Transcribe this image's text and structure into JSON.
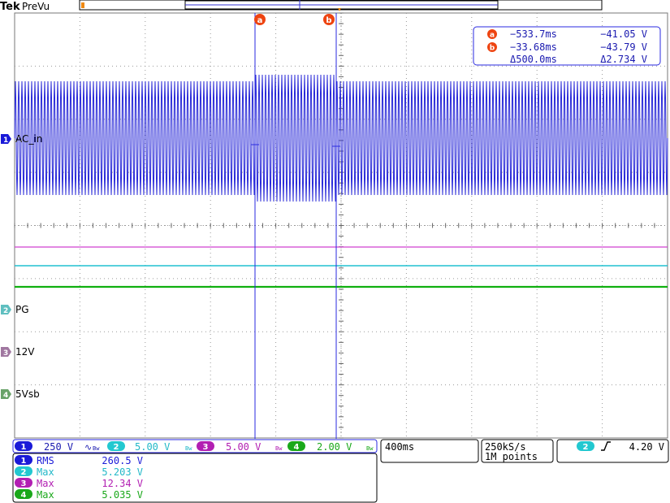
{
  "header": {
    "brand": "Tek",
    "mode": "PreVu"
  },
  "cursors": {
    "a": {
      "label": "a",
      "time": "−533.7ms",
      "volt": "−41.05 V"
    },
    "b": {
      "label": "b",
      "time": "−33.68ms",
      "volt": "−43.79 V"
    },
    "delta": {
      "time": "Δ500.0ms",
      "volt": "Δ2.734 V"
    }
  },
  "channels": [
    {
      "num": "1",
      "label": "AC_in",
      "scale": "250 V",
      "color": "#1a1ad8"
    },
    {
      "num": "2",
      "label": "PG",
      "scale": "5.00 V",
      "color": "#22d3d8"
    },
    {
      "num": "3",
      "label": "12V",
      "scale": "5.00 V",
      "color": "#b21fb2"
    },
    {
      "num": "4",
      "label": "5Vsb",
      "scale": "2.00 V",
      "color": "#1aa81a"
    }
  ],
  "measurements": [
    {
      "ch": "1",
      "name": "RMS",
      "value": "260.5 V"
    },
    {
      "ch": "2",
      "name": "Max",
      "value": "5.203 V"
    },
    {
      "ch": "3",
      "name": "Max",
      "value": "12.34 V"
    },
    {
      "ch": "4",
      "name": "Max",
      "value": "5.035 V"
    }
  ],
  "timebase": {
    "scale": "400ms"
  },
  "acquisition": {
    "rate": "250kS/s",
    "points": "1M points"
  },
  "trigger": {
    "ch": "2",
    "slope_icon": "rising-edge-icon",
    "level": "4.20 V"
  },
  "colors": {
    "cursor": "#2a2ae0",
    "orange": "#ee4411",
    "grid": "#9a9a9a"
  }
}
